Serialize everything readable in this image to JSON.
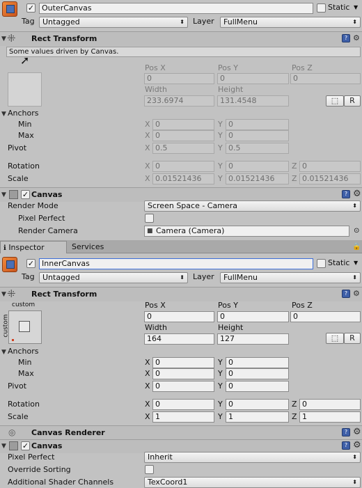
{
  "outer": {
    "name": "OuterCanvas",
    "static_label": "Static",
    "tag_label": "Tag",
    "tag_value": "Untagged",
    "layer_label": "Layer",
    "layer_value": "FullMenu",
    "rect_transform": {
      "title": "Rect Transform",
      "note": "Some values driven by Canvas.",
      "posx_label": "Pos X",
      "posy_label": "Pos Y",
      "posz_label": "Pos Z",
      "posx": "0",
      "posy": "0",
      "posz": "0",
      "width_label": "Width",
      "height_label": "Height",
      "width": "233.6974",
      "height": "131.4548",
      "blueprint_btn": "⬚",
      "raw_btn": "R",
      "anchors_label": "Anchors",
      "min_label": "Min",
      "max_label": "Max",
      "pivot_label": "Pivot",
      "min_x": "0",
      "min_y": "0",
      "max_x": "0",
      "max_y": "0",
      "pivot_x": "0.5",
      "pivot_y": "0.5",
      "rotation_label": "Rotation",
      "scale_label": "Scale",
      "rot_x": "0",
      "rot_y": "0",
      "rot_z": "0",
      "scale_x": "0.01521436",
      "scale_y": "0.01521436",
      "scale_z": "0.01521436",
      "x": "X",
      "y": "Y",
      "z": "Z"
    },
    "canvas": {
      "title": "Canvas",
      "render_mode_label": "Render Mode",
      "render_mode_value": "Screen Space - Camera",
      "pixel_perfect_label": "Pixel Perfect",
      "render_camera_label": "Render Camera",
      "render_camera_value": "Camera (Camera)"
    }
  },
  "tabs": [
    {
      "label": "Inspector",
      "icon": "info-icon"
    },
    {
      "label": "Services"
    }
  ],
  "inner": {
    "name": "InnerCanvas",
    "static_label": "Static",
    "tag_label": "Tag",
    "tag_value": "Untagged",
    "layer_label": "Layer",
    "layer_value": "FullMenu",
    "rect_transform": {
      "title": "Rect Transform",
      "anchor_preset_top": "custom",
      "anchor_preset_side": "custom",
      "posx_label": "Pos X",
      "posy_label": "Pos Y",
      "posz_label": "Pos Z",
      "posx": "0",
      "posy": "0",
      "posz": "0",
      "width_label": "Width",
      "height_label": "Height",
      "width": "164",
      "height": "127",
      "blueprint_btn": "⬚",
      "raw_btn": "R",
      "anchors_label": "Anchors",
      "min_label": "Min",
      "max_label": "Max",
      "pivot_label": "Pivot",
      "min_x": "0",
      "min_y": "0",
      "max_x": "0",
      "max_y": "0",
      "pivot_x": "0",
      "pivot_y": "0",
      "rotation_label": "Rotation",
      "scale_label": "Scale",
      "rot_x": "0",
      "rot_y": "0",
      "rot_z": "0",
      "scale_x": "1",
      "scale_y": "1",
      "scale_z": "1",
      "x": "X",
      "y": "Y",
      "z": "Z"
    },
    "canvas_renderer": {
      "title": "Canvas Renderer"
    },
    "canvas": {
      "title": "Canvas",
      "pixel_perfect_label": "Pixel Perfect",
      "pixel_perfect_value": "Inherit",
      "override_sorting_label": "Override Sorting",
      "shader_channels_label": "Additional Shader Channels",
      "shader_channels_value": "TexCoord1"
    }
  }
}
